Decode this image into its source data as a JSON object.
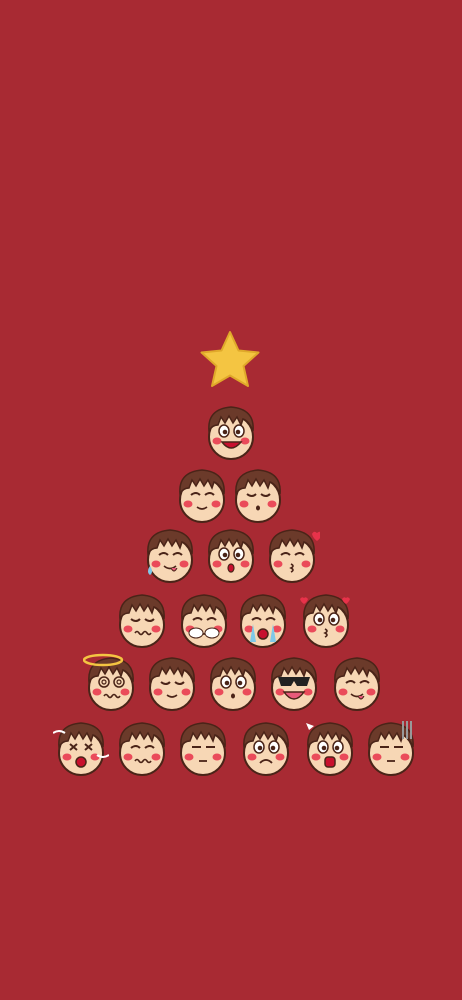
{
  "wallpaper": {
    "background_color": "#a82a33",
    "star_color": "#f4c542",
    "skin_color": "#f7d7b5",
    "hair_color": "#6b3a2a",
    "outline_color": "#4a2418",
    "cheek_color": "#e8324a"
  },
  "tree": {
    "star_icon": "star-icon",
    "rows": [
      [
        "grin-big"
      ],
      [
        "content-closed-eyes",
        "calm-closed-eyes"
      ],
      [
        "sweat-tongue",
        "surprised-o",
        "kiss-heart"
      ],
      [
        "worried-wavy",
        "crying-hands",
        "tears-stream",
        "hearts-eyes"
      ],
      [
        "dizzy-halo",
        "sleepy-smirk",
        "small-o",
        "sunglasses-laugh",
        "tongue-wink"
      ],
      [
        "sobbing-wind",
        "wavy-mouth",
        "flat-squint",
        "frown",
        "shocked-spark",
        "gloom-sweat"
      ]
    ]
  }
}
